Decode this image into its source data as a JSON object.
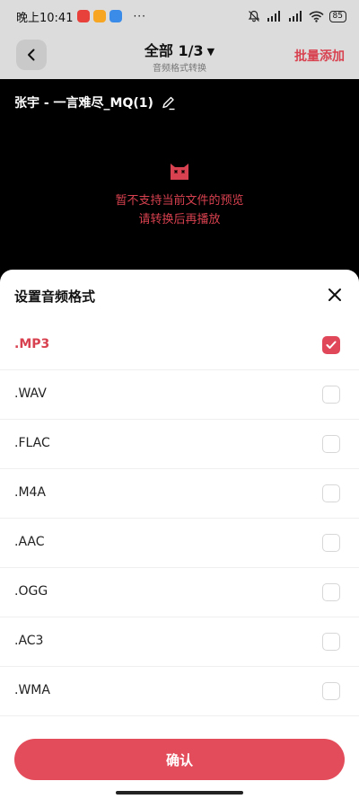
{
  "status_bar": {
    "time": "晚上10:41",
    "more": "···",
    "battery": "85",
    "app_icons": [
      {
        "name": "weibo-icon",
        "color": "#e8403b"
      },
      {
        "name": "notes-app-icon",
        "color": "#f6a623"
      },
      {
        "name": "gallery-app-icon",
        "color": "#3b8ce8"
      }
    ]
  },
  "header": {
    "title": "全部 1/3",
    "subtitle": "音频格式转换",
    "action": "批量添加"
  },
  "preview": {
    "file_name": "张宇 - 一言难尽_MQ(1)",
    "message_line1": "暂不支持当前文件的预览",
    "message_line2": "请转换后再播放"
  },
  "sheet": {
    "title": "设置音频格式",
    "formats": [
      {
        "label": ".MP3",
        "checked": true
      },
      {
        "label": ".WAV",
        "checked": false
      },
      {
        "label": ".FLAC",
        "checked": false
      },
      {
        "label": ".M4A",
        "checked": false
      },
      {
        "label": ".AAC",
        "checked": false
      },
      {
        "label": ".OGG",
        "checked": false
      },
      {
        "label": ".AC3",
        "checked": false
      },
      {
        "label": ".WMA",
        "checked": false
      }
    ],
    "confirm_label": "确认"
  },
  "colors": {
    "accent": "#e34c5b",
    "header_bg": "#dcdcdc"
  }
}
